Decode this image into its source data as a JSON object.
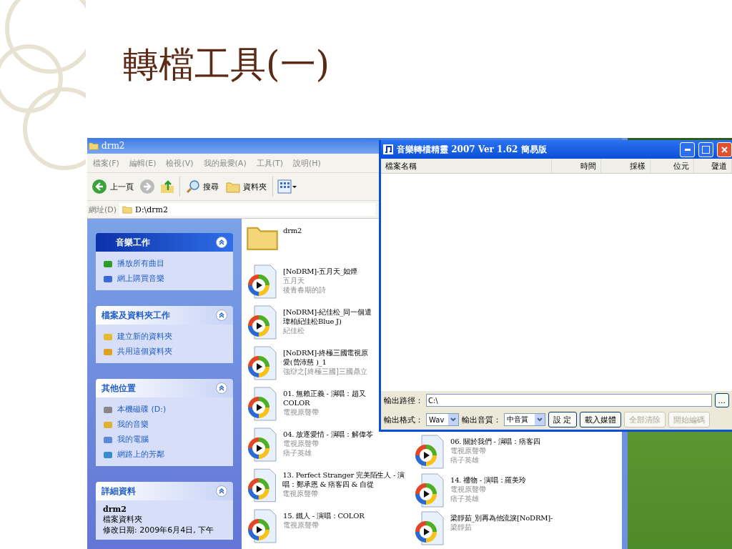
{
  "slide_title": "轉檔工具(一)",
  "explorer": {
    "title": "drm2",
    "menu": [
      "檔案(F)",
      "編輯(E)",
      "檢視(V)",
      "我的最愛(A)",
      "工具(T)",
      "說明(H)"
    ],
    "toolbar": {
      "back": "上一頁",
      "search": "搜尋",
      "folders": "資料夾"
    },
    "address": {
      "label": "網址(D)",
      "value": "D:\\drm2"
    },
    "task_panels": [
      {
        "kind": "special",
        "title": "音樂工作",
        "items": [
          "播放所有曲目",
          "網上購買音樂"
        ]
      },
      {
        "kind": "normal",
        "title": "檔案及資料夾工作",
        "items": [
          "建立新的資料夾",
          "共用這個資料夾"
        ]
      },
      {
        "kind": "normal",
        "title": "其他位置",
        "items": [
          "本機磁碟 (D:)",
          "我的音樂",
          "我的電腦",
          "網路上的芳鄰"
        ]
      },
      {
        "kind": "details",
        "title": "詳細資料",
        "items": [
          "drm2",
          "檔案資料夾",
          "修改日期: 2009年6月4日, 下午"
        ]
      }
    ],
    "files_column_1": [
      {
        "kind": "folder",
        "name_lines": [
          "drm2"
        ]
      },
      {
        "kind": "audio",
        "name_lines": [
          "[NoDRM]-五月天_如煙"
        ],
        "details": [
          "五月天",
          "後青春期的詩"
        ]
      },
      {
        "kind": "audio",
        "name_lines": [
          "[NoDRM]-紀佳松_同一個遣",
          "瑋柏紀佳松Blue J)"
        ],
        "details": [
          "紀佳松"
        ]
      },
      {
        "kind": "audio",
        "name_lines": [
          "[NoDRM]-終極三國電視原",
          "愛(曾沛慈 )_1"
        ],
        "details": [
          "強辯之[終極三國]三國鼎立"
        ]
      },
      {
        "kind": "audio",
        "name_lines": [
          "01. 無賴正義 - 演唱：趙又",
          "COLOR"
        ],
        "details": [
          "電視原聲帶"
        ]
      },
      {
        "kind": "audio",
        "name_lines": [
          "04. 放逐愛情 - 演唱：解偉苓"
        ],
        "details": [
          "電視原聲帶",
          "痞子英雄"
        ]
      },
      {
        "kind": "audio",
        "name_lines": [
          "13. Perfect Stranger 完美陌生人 - 演",
          "唱：鄭承恩 & 痞客四 & 自從"
        ],
        "details": [
          "電視原聲帶"
        ]
      },
      {
        "kind": "audio",
        "name_lines": [
          "15. 鐵人 - 演唱：COLOR"
        ],
        "details": [
          "電視原聲帶"
        ]
      }
    ],
    "files_column_2": [
      {
        "kind": "audio",
        "name_lines": [
          "06. 關於我們 - 演唱：痞客四"
        ],
        "details": [
          "電視原聲帶",
          "痞子英雄"
        ]
      },
      {
        "kind": "audio",
        "name_lines": [
          "14. 禮物 - 演唱：羅美玲"
        ],
        "details": [
          "電視原聲帶",
          "痞子英雄"
        ]
      },
      {
        "kind": "audio",
        "name_lines": [
          "梁靜茹_別再為他流淚[NoDRM]-"
        ],
        "details": [
          "梁靜茹"
        ]
      }
    ]
  },
  "converter": {
    "title": "音樂轉檔精靈 2007 Ver 1.62 簡易版",
    "columns": [
      "檔案名稱",
      "時間",
      "採樣",
      "位元",
      "聲道"
    ],
    "output_path": {
      "label": "輸出路徑：",
      "value": "C:\\",
      "browse": "..."
    },
    "output_format": {
      "label": "輸出格式：",
      "value": "Wav"
    },
    "output_quality": {
      "label": "輸出音質：",
      "value": "中音質"
    },
    "buttons": [
      {
        "label": "設 定",
        "disabled": false
      },
      {
        "label": "載入媒體",
        "disabled": false
      },
      {
        "label": "全部清除",
        "disabled": true
      },
      {
        "label": "開始編碼",
        "disabled": true
      }
    ]
  }
}
